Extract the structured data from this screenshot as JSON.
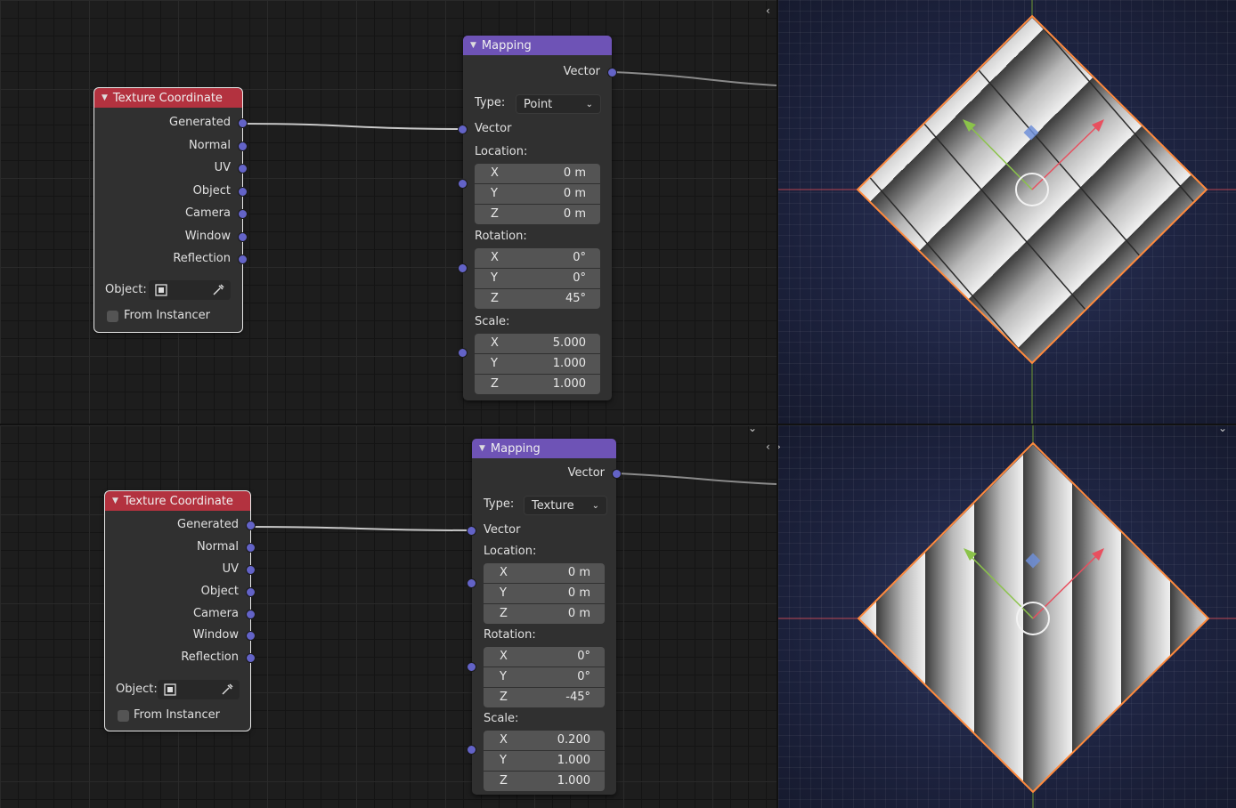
{
  "panels": [
    {
      "texcoord": {
        "title": "Texture Coordinate",
        "outputs": [
          "Generated",
          "Normal",
          "UV",
          "Object",
          "Camera",
          "Window",
          "Reflection"
        ],
        "object_label": "Object:",
        "from_instancer": "From Instancer"
      },
      "mapping": {
        "title": "Mapping",
        "output": "Vector",
        "type_label": "Type:",
        "type_value": "Point",
        "vector_input": "Vector",
        "location_label": "Location:",
        "location": [
          {
            "axis": "X",
            "value": "0 m"
          },
          {
            "axis": "Y",
            "value": "0 m"
          },
          {
            "axis": "Z",
            "value": "0 m"
          }
        ],
        "rotation_label": "Rotation:",
        "rotation": [
          {
            "axis": "X",
            "value": "0°"
          },
          {
            "axis": "Y",
            "value": "0°"
          },
          {
            "axis": "Z",
            "value": "45°"
          }
        ],
        "scale_label": "Scale:",
        "scale": [
          {
            "axis": "X",
            "value": "5.000"
          },
          {
            "axis": "Y",
            "value": "1.000"
          },
          {
            "axis": "Z",
            "value": "1.000"
          }
        ]
      }
    },
    {
      "texcoord": {
        "title": "Texture Coordinate",
        "outputs": [
          "Generated",
          "Normal",
          "UV",
          "Object",
          "Camera",
          "Window",
          "Reflection"
        ],
        "object_label": "Object:",
        "from_instancer": "From Instancer"
      },
      "mapping": {
        "title": "Mapping",
        "output": "Vector",
        "type_label": "Type:",
        "type_value": "Texture",
        "vector_input": "Vector",
        "location_label": "Location:",
        "location": [
          {
            "axis": "X",
            "value": "0 m"
          },
          {
            "axis": "Y",
            "value": "0 m"
          },
          {
            "axis": "Z",
            "value": "0 m"
          }
        ],
        "rotation_label": "Rotation:",
        "rotation": [
          {
            "axis": "X",
            "value": "0°"
          },
          {
            "axis": "Y",
            "value": "0°"
          },
          {
            "axis": "Z",
            "value": "-45°"
          }
        ],
        "scale_label": "Scale:",
        "scale": [
          {
            "axis": "X",
            "value": "0.200"
          },
          {
            "axis": "Y",
            "value": "1.000"
          },
          {
            "axis": "Z",
            "value": "1.000"
          }
        ]
      }
    }
  ],
  "colors": {
    "texcoord_header": "#b3323f",
    "mapping_header": "#6e53b6",
    "socket_vector": "#6363c7",
    "selection_outline": "#ff8a3d",
    "x_axis": "#e8505f",
    "y_axis": "#8bc34a"
  },
  "icons": {
    "object_picker": "object-cube-icon",
    "eyedropper": "eyedropper-icon",
    "collapse": "triangle-down-icon",
    "dropdown": "chevron-down-icon",
    "gizmo_origin": "origin-diamond-icon"
  }
}
